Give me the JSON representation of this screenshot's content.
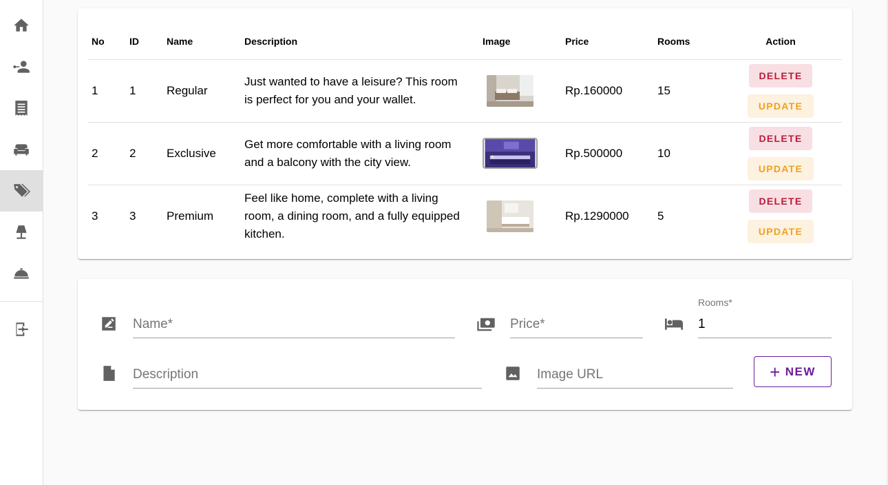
{
  "sidebar": {
    "items": [
      {
        "icon": "home-icon"
      },
      {
        "icon": "user-key-icon"
      },
      {
        "icon": "receipt-icon"
      },
      {
        "icon": "sofa-icon"
      },
      {
        "icon": "tags-icon",
        "active": true
      },
      {
        "icon": "lamp-icon"
      },
      {
        "icon": "room-service-icon"
      },
      {
        "icon": "logout-icon"
      }
    ]
  },
  "table": {
    "headers": [
      "No",
      "ID",
      "Name",
      "Description",
      "Image",
      "Price",
      "Rooms",
      "Action"
    ],
    "rows": [
      {
        "no": "1",
        "id": "1",
        "name": "Regular",
        "description": "Just wanted to have a leisure? This room is perfect for you and your wallet.",
        "price": "Rp.160000",
        "rooms": "15",
        "delete_label": "DELETE",
        "update_label": "UPDATE"
      },
      {
        "no": "2",
        "id": "2",
        "name": "Exclusive",
        "description": "Get more comfortable with a living room and a balcony with the city view.",
        "price": "Rp.500000",
        "rooms": "10",
        "delete_label": "DELETE",
        "update_label": "UPDATE"
      },
      {
        "no": "3",
        "id": "3",
        "name": "Premium",
        "description": "Feel like home, complete with a living room, a dining room, and a fully equipped kitchen.",
        "price": "Rp.1290000",
        "rooms": "5",
        "delete_label": "DELETE",
        "update_label": "UPDATE"
      }
    ]
  },
  "form": {
    "name_placeholder": "Name*",
    "price_placeholder": "Price*",
    "rooms_label": "Rooms*",
    "rooms_value": "1",
    "description_placeholder": "Description",
    "image_placeholder": "Image URL",
    "new_label": "NEW"
  },
  "colors": {
    "delete_text": "#b71c3a",
    "delete_bg": "#f8dfe4",
    "update_text": "#f0a020",
    "update_bg": "#fdf1df",
    "accent": "#6a1b9a"
  }
}
